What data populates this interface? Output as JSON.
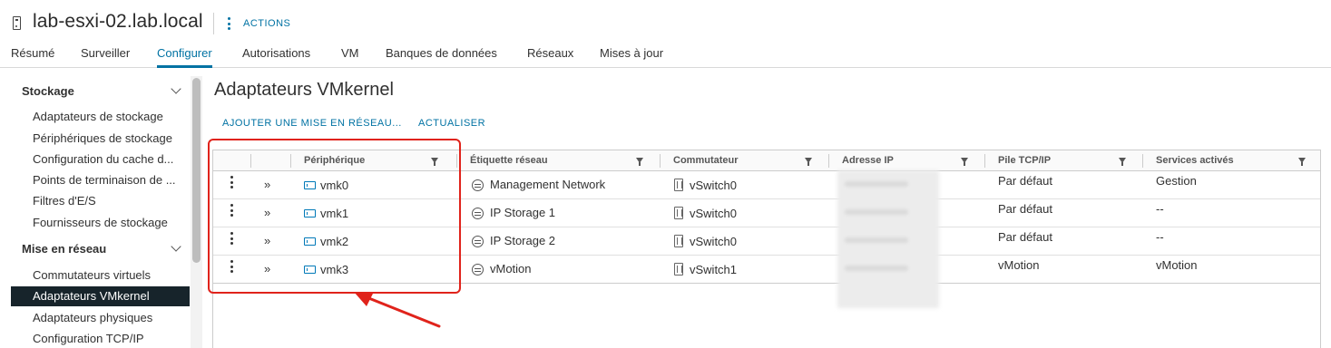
{
  "header": {
    "host_name": "lab-esxi-02.lab.local",
    "actions_label": "ACTIONS"
  },
  "tabs": [
    {
      "label": "Résumé"
    },
    {
      "label": "Surveiller"
    },
    {
      "label": "Configurer"
    },
    {
      "label": "Autorisations"
    },
    {
      "label": "VM"
    },
    {
      "label": "Banques de données"
    },
    {
      "label": "Réseaux"
    },
    {
      "label": "Mises à jour"
    }
  ],
  "active_tab": "Configurer",
  "sidebar": {
    "groups": [
      {
        "label": "Stockage",
        "items": [
          "Adaptateurs de stockage",
          "Périphériques de stockage",
          "Configuration du cache d...",
          "Points de terminaison de ...",
          "Filtres d'E/S",
          "Fournisseurs de stockage"
        ]
      },
      {
        "label": "Mise en réseau",
        "items": [
          "Commutateurs virtuels",
          "Adaptateurs VMkernel",
          "Adaptateurs physiques",
          "Configuration TCP/IP"
        ]
      }
    ],
    "selected": "Adaptateurs VMkernel"
  },
  "main": {
    "title": "Adaptateurs VMkernel",
    "toolbar": {
      "add_label": "AJOUTER UNE MISE EN RÉSEAU...",
      "refresh_label": "ACTUALISER"
    },
    "columns": [
      "Périphérique",
      "Étiquette réseau",
      "Commutateur",
      "Adresse IP",
      "Pile TCP/IP",
      "Services activés"
    ],
    "rows": [
      {
        "device": "vmk0",
        "label": "Management Network",
        "switch": "vSwitch0",
        "ip": "",
        "stack": "Par défaut",
        "services": "Gestion"
      },
      {
        "device": "vmk1",
        "label": "IP Storage 1",
        "switch": "vSwitch0",
        "ip": "",
        "stack": "Par défaut",
        "services": "--"
      },
      {
        "device": "vmk2",
        "label": "IP Storage 2",
        "switch": "vSwitch0",
        "ip": "",
        "stack": "Par défaut",
        "services": "--"
      },
      {
        "device": "vmk3",
        "label": "vMotion",
        "switch": "vSwitch1",
        "ip": "",
        "stack": "vMotion",
        "services": "vMotion"
      }
    ]
  },
  "colors": {
    "accent": "#0072a3",
    "selected_bg": "#17242b",
    "annotation": "#e0231b"
  }
}
